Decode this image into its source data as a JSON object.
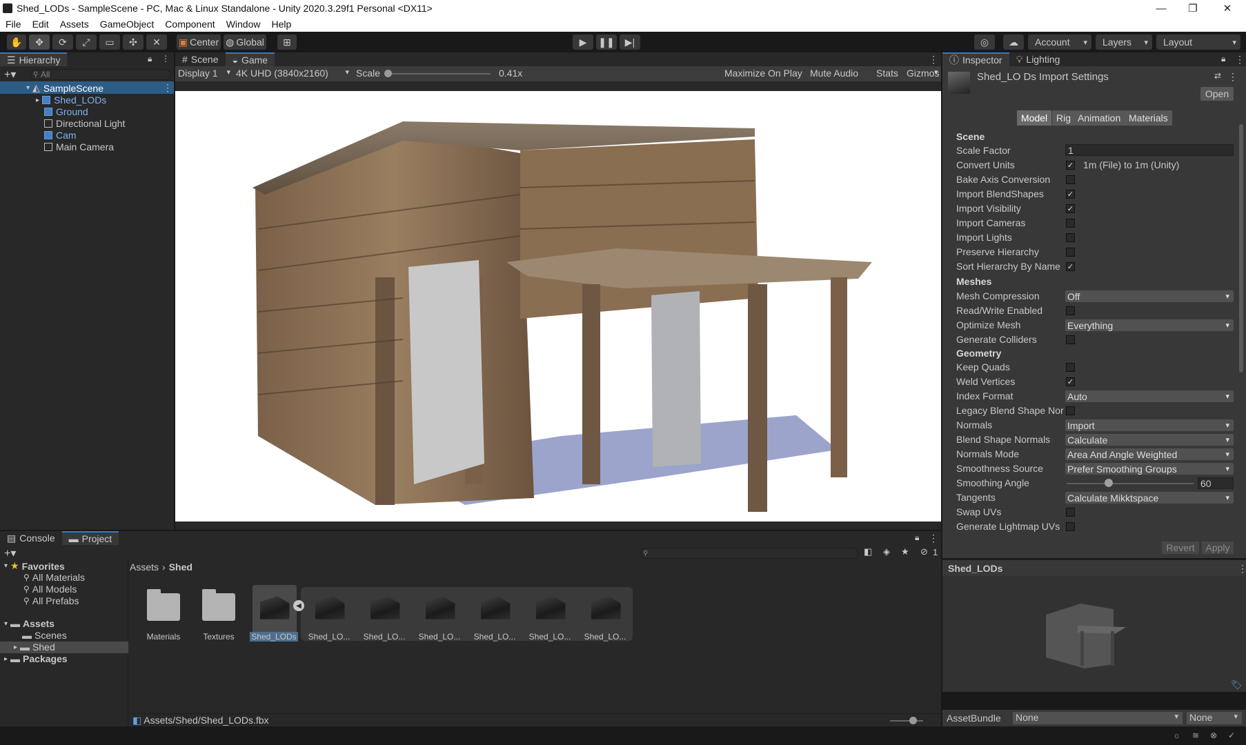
{
  "window": {
    "title": "Shed_LODs - SampleScene - PC, Mac & Linux Standalone - Unity 2020.3.29f1 Personal <DX11>",
    "controls": [
      "—",
      "❐",
      "✕"
    ]
  },
  "menu": [
    "File",
    "Edit",
    "Assets",
    "GameObject",
    "Component",
    "Window",
    "Help"
  ],
  "toolbar": {
    "tools": [
      "hand-tool-icon",
      "move-tool-icon",
      "rotate-tool-icon",
      "scale-tool-icon",
      "rect-tool-icon",
      "transform-tool-icon",
      "custom-tool-icon"
    ],
    "pivot": "Center",
    "space": "Global",
    "account": "Account",
    "layers": "Layers",
    "layout": "Layout"
  },
  "hierarchy": {
    "tab": "Hierarchy",
    "search_placeholder": "All",
    "scene": "SampleScene",
    "items": [
      {
        "label": "Shed_LODs",
        "blue": true
      },
      {
        "label": "Ground",
        "blue": true
      },
      {
        "label": "Directional Light",
        "blue": false
      },
      {
        "label": "Cam",
        "blue": true
      },
      {
        "label": "Main Camera",
        "blue": false
      }
    ]
  },
  "view": {
    "tabs": [
      "Scene",
      "Game"
    ],
    "display": "Display 1",
    "resolution": "4K UHD (3840x2160)",
    "scale_label": "Scale",
    "scale_value": "0.41x",
    "scale_fraction": 0.0,
    "buttons": [
      "Maximize On Play",
      "Mute Audio",
      "Stats",
      "Gizmos"
    ]
  },
  "inspector": {
    "tabs": [
      "Inspector",
      "Lighting"
    ],
    "title": "Shed_LO Ds Import Settings",
    "open_button": "Open",
    "subtabs": [
      "Model",
      "Rig",
      "Animation",
      "Materials"
    ],
    "sections": {
      "scene": "Scene",
      "meshes": "Meshes",
      "geometry": "Geometry"
    },
    "scale_factor_label": "Scale Factor",
    "scale_factor_value": "1",
    "convert_units_label": "Convert Units",
    "convert_units_value": "1m (File) to 1m (Unity)",
    "checkboxes": [
      {
        "label": "Bake Axis Conversion",
        "checked": false
      },
      {
        "label": "Import BlendShapes",
        "checked": true
      },
      {
        "label": "Import Visibility",
        "checked": true
      },
      {
        "label": "Import Cameras",
        "checked": false
      },
      {
        "label": "Import Lights",
        "checked": false
      },
      {
        "label": "Preserve Hierarchy",
        "checked": false
      },
      {
        "label": "Sort Hierarchy By Name",
        "checked": true
      }
    ],
    "mesh_compression_label": "Mesh Compression",
    "mesh_compression_value": "Off",
    "read_write_label": "Read/Write Enabled",
    "optimize_mesh_label": "Optimize Mesh",
    "optimize_mesh_value": "Everything",
    "generate_colliders_label": "Generate Colliders",
    "keep_quads_label": "Keep Quads",
    "weld_vertices_label": "Weld Vertices",
    "index_format_label": "Index Format",
    "index_format_value": "Auto",
    "legacy_blend_label": "Legacy Blend Shape Nor",
    "normals_label": "Normals",
    "normals_value": "Import",
    "blend_shape_normals_label": "Blend Shape Normals",
    "blend_shape_normals_value": "Calculate",
    "normals_mode_label": "Normals Mode",
    "normals_mode_value": "Area And Angle Weighted",
    "smoothness_source_label": "Smoothness Source",
    "smoothness_source_value": "Prefer Smoothing Groups",
    "smoothing_angle_label": "Smoothing Angle",
    "smoothing_angle_value": "60",
    "smoothing_angle_fraction": 0.33,
    "tangents_label": "Tangents",
    "tangents_value": "Calculate Mikktspace",
    "swap_uvs_label": "Swap UVs",
    "lightmap_uvs_label": "Generate Lightmap UVs",
    "revert": "Revert",
    "apply": "Apply",
    "preview_title": "Shed_LODs",
    "assetbundle_label": "AssetBundle",
    "assetbundle_value": "None",
    "assetbundle_variant": "None"
  },
  "project": {
    "tabs": [
      "Console",
      "Project"
    ],
    "favorites_label": "Favorites",
    "favorites": [
      "All Materials",
      "All Models",
      "All Prefabs"
    ],
    "assets_label": "Assets",
    "asset_folders": [
      "Scenes",
      "Shed"
    ],
    "packages_label": "Packages",
    "breadcrumb": [
      "Assets",
      "Shed"
    ],
    "hidden_count": "1",
    "items": [
      {
        "label": "Materials",
        "kind": "folder"
      },
      {
        "label": "Textures",
        "kind": "folder"
      },
      {
        "label": "Shed_LODs",
        "kind": "model"
      },
      {
        "label": "Shed_LO...",
        "kind": "mesh"
      },
      {
        "label": "Shed_LO...",
        "kind": "mesh"
      },
      {
        "label": "Shed_LO...",
        "kind": "mesh"
      },
      {
        "label": "Shed_LO...",
        "kind": "mesh"
      },
      {
        "label": "Shed_LO...",
        "kind": "mesh"
      },
      {
        "label": "Shed_LO...",
        "kind": "mesh"
      }
    ],
    "footer_path": "Assets/Shed/Shed_LODs.fbx"
  }
}
